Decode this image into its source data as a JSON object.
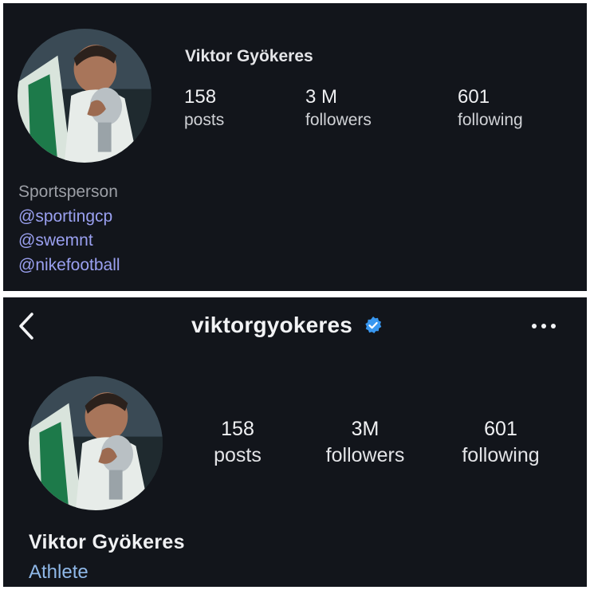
{
  "profile_card_old": {
    "display_name": "Viktor Gyökeres",
    "stats": [
      {
        "value": "158",
        "label": "posts"
      },
      {
        "value": "3 M",
        "label": "followers"
      },
      {
        "value": "601",
        "label": "following"
      }
    ],
    "category": "Sportsperson",
    "bio_links": [
      "@sportingcp",
      "@swemnt",
      "@nikefootball"
    ]
  },
  "profile_card_new": {
    "nav": {
      "back_icon": "chevron-left-icon",
      "username": "viktorgyokeres",
      "verified_icon": "verified-badge-icon",
      "more_icon": "more-horizontal-icon"
    },
    "stats": [
      {
        "value": "158",
        "label": "posts"
      },
      {
        "value": "3M",
        "label": "followers"
      },
      {
        "value": "601",
        "label": "following"
      }
    ],
    "display_name": "Viktor Gyökeres",
    "category": "Athlete"
  },
  "colors": {
    "background": "#12151b",
    "text": "#f0f1f3",
    "link": "#9aa0f0",
    "category_new": "#8fb8e8",
    "verified": "#3897f0"
  }
}
